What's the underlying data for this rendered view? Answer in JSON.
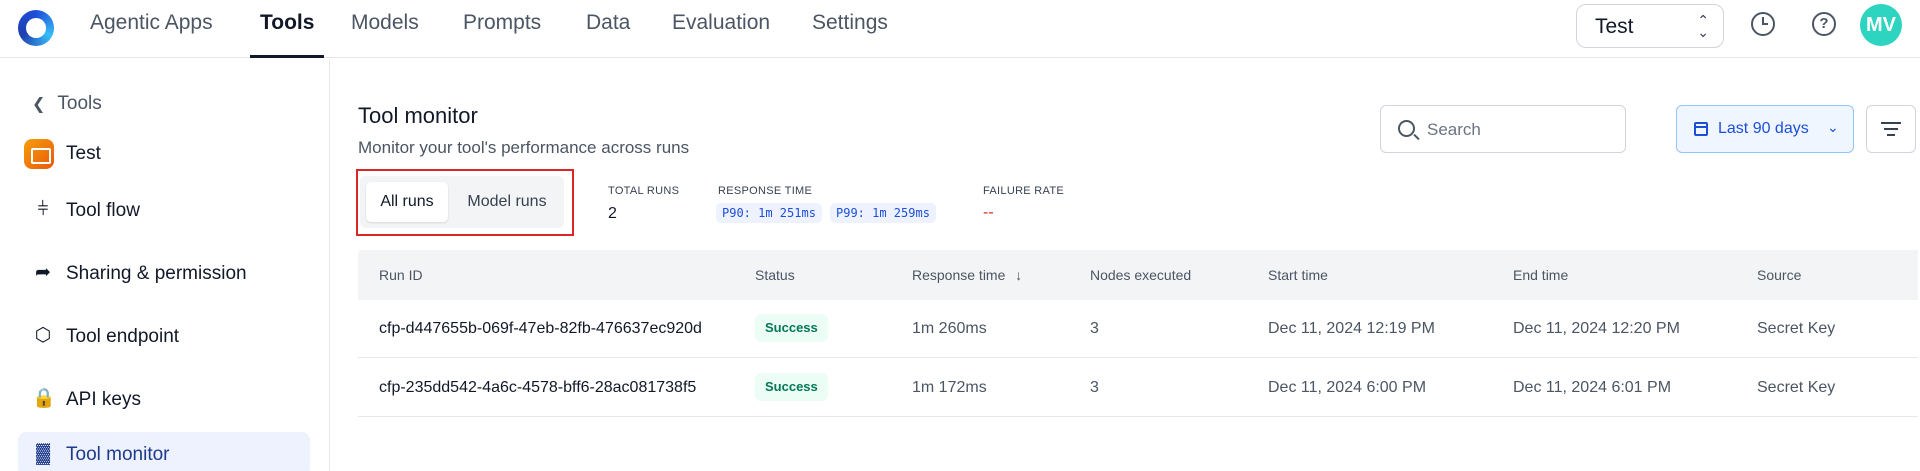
{
  "nav": {
    "items": [
      "Agentic Apps",
      "Tools",
      "Models",
      "Prompts",
      "Data",
      "Evaluation",
      "Settings"
    ],
    "active": "Tools",
    "tenant": "Test",
    "avatar": "MV"
  },
  "sidebar": {
    "back_label": "Tools",
    "project_name": "Test",
    "items": [
      {
        "label": "Tool flow",
        "icon": "flow-icon"
      },
      {
        "label": "Sharing & permission",
        "icon": "share-icon"
      },
      {
        "label": "Tool endpoint",
        "icon": "cube-icon"
      },
      {
        "label": "API keys",
        "icon": "lock-icon"
      },
      {
        "label": "Tool monitor",
        "icon": "bar-chart-icon",
        "active": true
      }
    ]
  },
  "main": {
    "title": "Tool monitor",
    "subtitle": "Monitor your tool's performance across runs",
    "search_placeholder": "Search",
    "date_range": "Last 90 days",
    "tabs": [
      "All runs",
      "Model runs"
    ],
    "active_tab": "All runs",
    "stats": {
      "total_runs_label": "TOTAL RUNS",
      "total_runs_value": "2",
      "response_time_label": "RESPONSE TIME",
      "p90": "P90: 1m 251ms",
      "p99": "P99: 1m 259ms",
      "failure_rate_label": "FAILURE RATE",
      "failure_rate_value": "--"
    },
    "table": {
      "columns": [
        "Run ID",
        "Status",
        "Response time",
        "Nodes executed",
        "Start time",
        "End time",
        "Source"
      ],
      "rows": [
        [
          "cfp-d447655b-069f-47eb-82fb-476637ec920d",
          "Success",
          "1m 260ms",
          "3",
          "Dec 11, 2024 12:19 PM",
          "Dec 11, 2024 12:20 PM",
          "Secret Key"
        ],
        [
          "cfp-235dd542-4a6c-4578-bff6-28ac081738f5",
          "Success",
          "1m 172ms",
          "3",
          "Dec 11, 2024 6:00 PM",
          "Dec 11, 2024 6:01 PM",
          "Secret Key"
        ]
      ]
    }
  },
  "colors": {
    "accent": "#1d4ed8",
    "success": "#047857",
    "highlight_border": "#dc2626"
  }
}
